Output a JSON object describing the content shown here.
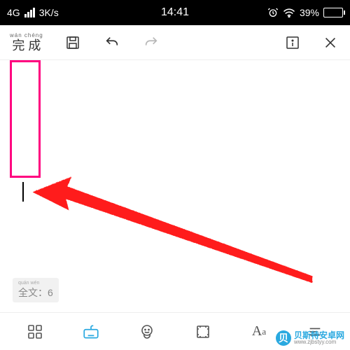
{
  "status": {
    "network": "4G",
    "speed": "3K/s",
    "time": "14:41",
    "battery_pct": "39%"
  },
  "toolbar": {
    "done_pinyin": "wán chéng",
    "done_label": "完 成"
  },
  "word_count": {
    "pinyin": "quán wén",
    "label": "全文",
    "value": "6"
  },
  "watermark": {
    "badge": "贝",
    "title": "贝斯特安卓网",
    "url": "www.zjbstyy.com"
  }
}
